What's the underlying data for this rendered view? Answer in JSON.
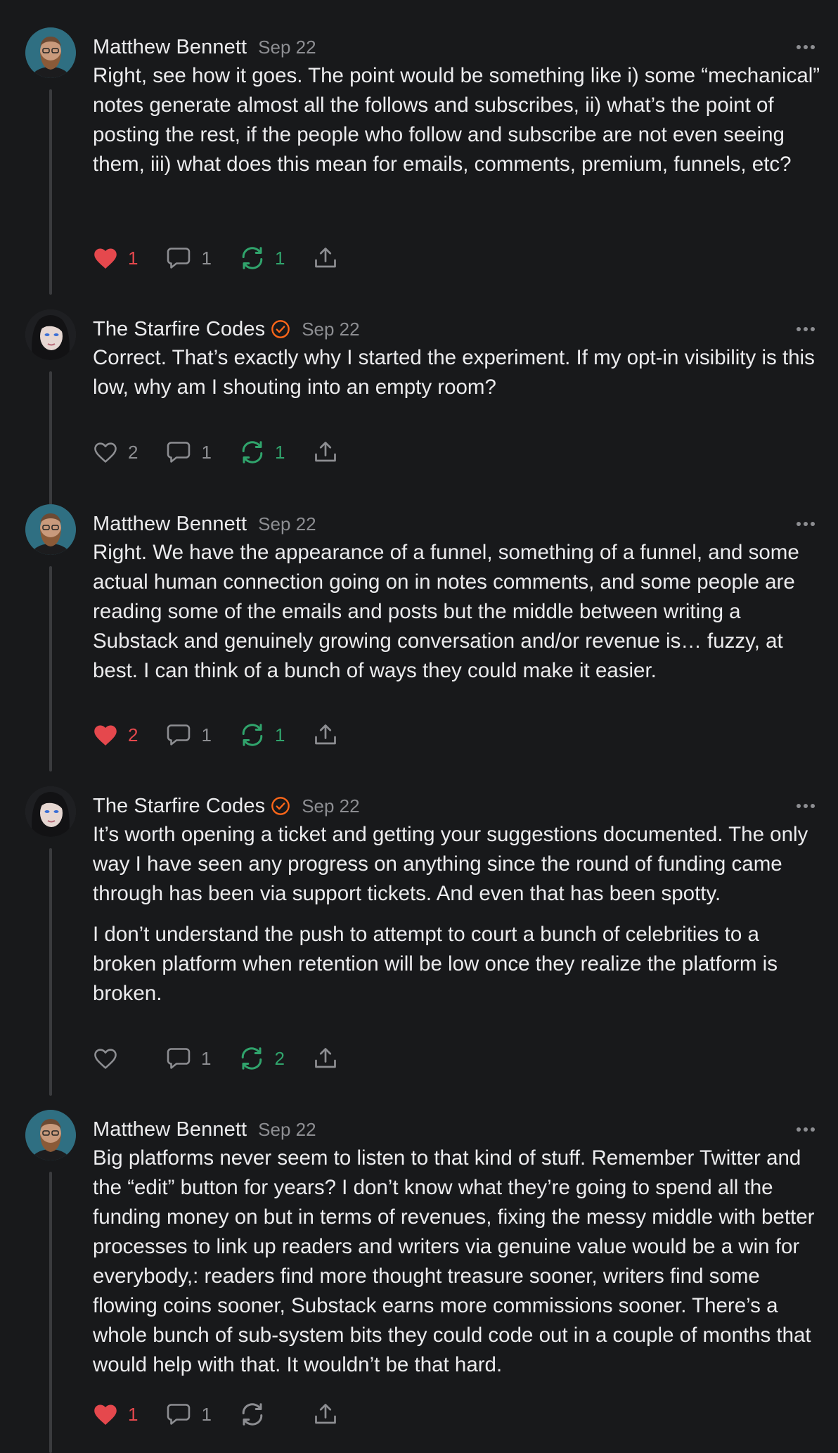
{
  "colors": {
    "background": "#18191b",
    "heart_active": "#e5484d",
    "restack_active": "#30a46c",
    "muted": "#8d8e92",
    "verified_badge": "#ff6719"
  },
  "comments": [
    {
      "author": "Matthew Bennett",
      "date": "Sep 22",
      "verified": false,
      "avatar": "bearded-man-avatar",
      "paragraphs": [
        "Right, see how it goes. The point would be something like i) some “mechanical” notes generate almost all the follows and subscribes, ii) what’s the point of posting the rest, if the people who follow and subscribe are not even seeing them, iii) what does this mean for emails, comments, premium, funnels, etc?"
      ],
      "likes": "1",
      "liked": true,
      "comments": "1",
      "restacks": "1",
      "restack_active": true
    },
    {
      "author": "The Starfire Codes",
      "date": "Sep 22",
      "verified": true,
      "avatar": "woman-avatar",
      "paragraphs": [
        "Correct. That’s exactly why I started the experiment. If my opt-in visibility is this low, why am I shouting into an empty room?"
      ],
      "likes": "2",
      "liked": false,
      "comments": "1",
      "restacks": "1",
      "restack_active": true
    },
    {
      "author": "Matthew Bennett",
      "date": "Sep 22",
      "verified": false,
      "avatar": "bearded-man-avatar",
      "paragraphs": [
        "Right. We have the appearance of a funnel, something of a funnel, and some actual human connection going on in notes comments, and some people are reading some of the emails and posts but the middle between writing a Substack and genuinely growing conversation and/or revenue is… fuzzy, at best. I can think of a bunch of ways they could make it easier."
      ],
      "likes": "2",
      "liked": true,
      "comments": "1",
      "restacks": "1",
      "restack_active": true
    },
    {
      "author": "The Starfire Codes",
      "date": "Sep 22",
      "verified": true,
      "avatar": "woman-avatar",
      "paragraphs": [
        "It’s worth opening a ticket and getting your suggestions documented. The only way I have seen any progress on anything since the round of funding came through has been via support tickets. And even that has been spotty.",
        "I don’t understand the push to attempt to court a bunch of celebrities to a broken platform when retention will be low once they realize the platform is broken."
      ],
      "likes": "",
      "liked": false,
      "comments": "1",
      "restacks": "2",
      "restack_active": true
    },
    {
      "author": "Matthew Bennett",
      "date": "Sep 22",
      "verified": false,
      "avatar": "bearded-man-avatar",
      "paragraphs": [
        "Big platforms never seem to listen to that kind of stuff. Remember Twitter and the “edit” button for years? I don’t know what they’re going to spend all the funding money on but in terms of revenues, fixing the messy middle with better processes to link up readers and writers via genuine value would be a win for everybody,: readers find more thought treasure sooner, writers find some flowing coins sooner, Substack earns more commissions sooner. There’s a whole bunch of sub-system bits they could code out in a couple of months that would help with that. It wouldn’t be that hard."
      ],
      "likes": "1",
      "liked": true,
      "comments": "1",
      "restacks": "",
      "restack_active": false
    }
  ]
}
